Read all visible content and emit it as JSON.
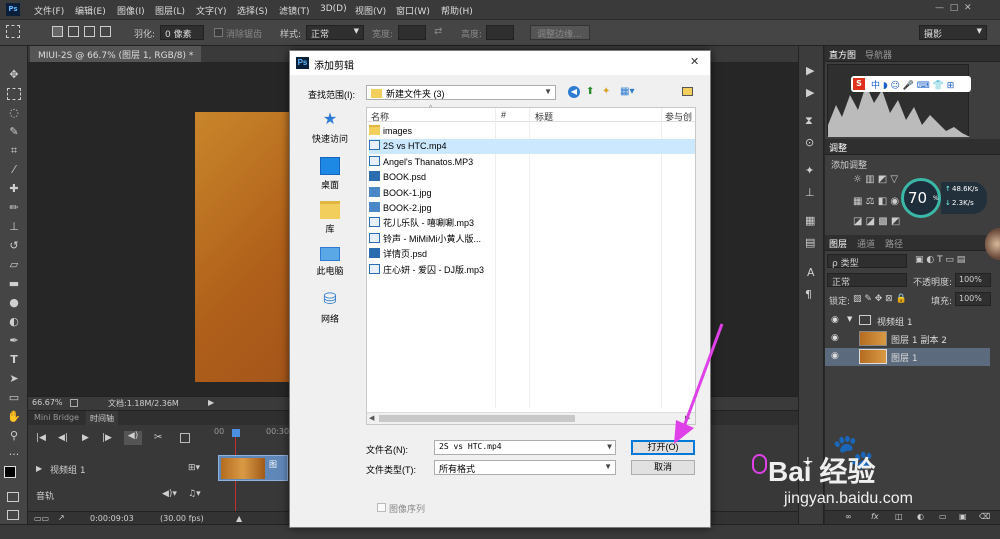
{
  "menubar": {
    "items": [
      "文件(F)",
      "编辑(E)",
      "图像(I)",
      "图层(L)",
      "文字(Y)",
      "选择(S)",
      "滤镜(T)",
      "3D(D)",
      "视图(V)",
      "窗口(W)",
      "帮助(H)"
    ]
  },
  "optbar": {
    "feather_label": "羽化:",
    "feather_value": "0 像素",
    "antialias_label": "消除锯齿",
    "style_label": "样式:",
    "style_value": "正常",
    "width_label": "宽度:",
    "height_label": "高度:",
    "refine_edge_button": "调整边缘...",
    "workspace": "摄影"
  },
  "document_tab": "MIUI-2S @ 66.7% (图层 1, RGB/8) *",
  "statusbar": {
    "zoom": "66.67%",
    "doc_info": "文档:1.18M/2.36M"
  },
  "timeline": {
    "tabs": [
      "Mini Bridge",
      "时间轴"
    ],
    "time_marker": "00:30f",
    "video_group": "视频组 1",
    "clip_label": "图",
    "audio_track": "音轨",
    "timecode": "0:00:09:03",
    "fps": "(30.00 fps)"
  },
  "panels": {
    "histogram_tabs": [
      "直方图",
      "导航器"
    ],
    "adjust_tab": "调整",
    "add_adjustment": "添加调整",
    "speed": {
      "percent": "70",
      "up": "48.6K/s",
      "down": "2.3K/s"
    },
    "layer_tabs": [
      "图层",
      "通道",
      "路径"
    ],
    "kind_label": "类型",
    "blend_mode": "正常",
    "opacity_label": "不透明度:",
    "opacity_value": "100%",
    "lock_label": "锁定:",
    "fill_label": "填充:",
    "fill_value": "100%",
    "layers": [
      "视频组 1",
      "图层 1 副本 2",
      "图层 1"
    ],
    "footer_icons": "fx"
  },
  "dialog": {
    "title": "添加剪辑",
    "lookin_label": "查找范围(I):",
    "lookin_value": "新建文件夹 (3)",
    "places": [
      "快速访问",
      "桌面",
      "库",
      "此电脑",
      "网络"
    ],
    "columns": [
      "名称",
      "#",
      "标题",
      "参与创"
    ],
    "files": [
      {
        "name": "images",
        "type": "folder"
      },
      {
        "name": "2S vs HTC.mp4",
        "type": "media"
      },
      {
        "name": "Angel's Thanatos.MP3",
        "type": "media"
      },
      {
        "name": "BOOK.psd",
        "type": "psd"
      },
      {
        "name": "BOOK-1.jpg",
        "type": "jpg"
      },
      {
        "name": "BOOK-2.jpg",
        "type": "jpg"
      },
      {
        "name": "花儿乐队 - 嘻唰唰.mp3",
        "type": "media"
      },
      {
        "name": "铃声 - MiMiMi小黄人版...",
        "type": "media"
      },
      {
        "name": "详情页.psd",
        "type": "psd"
      },
      {
        "name": "庄心妍 - 爱囚 - DJ版.mp3",
        "type": "media"
      }
    ],
    "filename_label": "文件名(N):",
    "filename_value": "2S vs HTC.mp4",
    "filetype_label": "文件类型(T):",
    "filetype_value": "所有格式",
    "open_button": "打开(O)",
    "cancel_button": "取消",
    "image_sequence_label": "图像序列"
  },
  "watermark": {
    "brand": "Bai 经验",
    "url": "jingyan.baidu.com"
  },
  "colors": {
    "accent_selection": "#cce8ff",
    "annotation_arrow": "#e040e8"
  }
}
